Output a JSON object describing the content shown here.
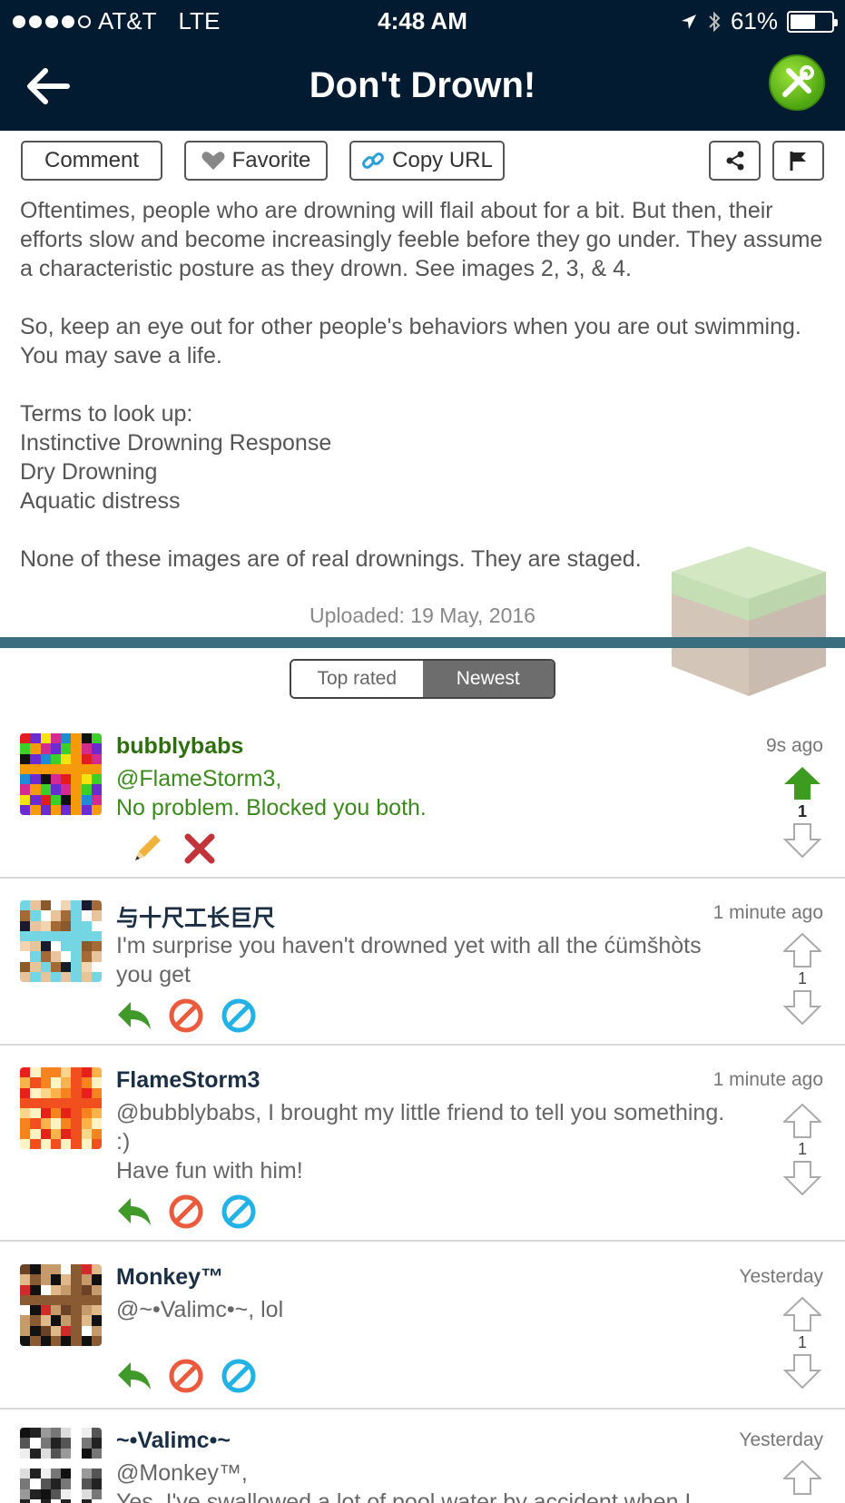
{
  "status": {
    "carrier": "AT&T",
    "network": "LTE",
    "time": "4:48 AM",
    "battery": "61%",
    "battery_level": 0.61
  },
  "nav": {
    "title": "Don't Drown!",
    "back_icon": "arrow-left-icon",
    "tools_icon": "tools-icon"
  },
  "actions": {
    "comment": "Comment",
    "favorite": "Favorite",
    "copy_url": "Copy URL",
    "share_icon": "share-icon",
    "flag_icon": "flag-icon"
  },
  "description": {
    "p1": "Oftentimes, people who are drowning will flail about for a bit.  But then, their efforts slow and become increasingly feeble before they go under.  They assume a characteristic posture as they drown.  See images 2, 3, & 4.",
    "p2": "So, keep an eye out for other people's behaviors when you are out swimming.  You may save a life.",
    "terms_heading": "Terms to look up:",
    "terms": [
      "Instinctive Drowning Response",
      "Dry Drowning",
      "Aquatic distress"
    ],
    "p3": "None of these images are of real drownings.  They are staged."
  },
  "uploaded": "Uploaded: 19 May, 2016",
  "sort": {
    "top_rated": "Top rated",
    "newest": "Newest",
    "selected": "Newest"
  },
  "comments": [
    {
      "user": "bubblybabs",
      "time": "9s ago",
      "lines": [
        "@FlameStorm3,",
        "No problem. Blocked you both."
      ],
      "votes": "1"
    },
    {
      "user": "与十尺工长巨尺",
      "time": "1 minute ago",
      "lines": [
        "I'm surprise you haven't drowned yet with all the ćümšhòts you get"
      ],
      "votes": "1"
    },
    {
      "user": "FlameStorm3",
      "time": "1 minute ago",
      "lines": [
        "@bubblybabs, I brought my little friend to tell you something. :)",
        "Have fun with him!"
      ],
      "votes": "1"
    },
    {
      "user": "Monkey™",
      "time": "Yesterday",
      "lines": [
        "@~•Valimc•~, lol"
      ],
      "votes": "1"
    },
    {
      "user": "~•Valimc•~",
      "time": "Yesterday",
      "lines": [
        "@Monkey™,",
        "Yes, I've swallowed a lot of pool water by accident when I"
      ],
      "votes": ""
    }
  ],
  "colors": {
    "header_bg": "#031b30",
    "divider": "#3b6f80",
    "own_comment_green": "#3a8a1c",
    "upvote_active": "#3d9b1f"
  }
}
